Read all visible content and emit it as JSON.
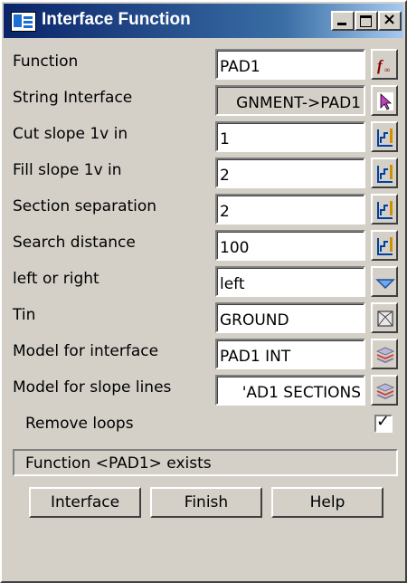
{
  "window": {
    "title": "Interface Function"
  },
  "rows": [
    {
      "label": "Function",
      "value": "PAD1",
      "icon": "function-fx-icon"
    },
    {
      "label": "String Interface",
      "value": "GNMENT->PAD1",
      "icon": "pick-arrow-icon"
    },
    {
      "label": "Cut slope  1v in",
      "value": "1",
      "icon": "value-select-icon"
    },
    {
      "label": "Fill slope 1v in",
      "value": "2",
      "icon": "value-select-icon"
    },
    {
      "label": "Section separation",
      "value": "2",
      "icon": "value-select-icon"
    },
    {
      "label": "Search distance",
      "value": "100",
      "icon": "value-select-icon"
    },
    {
      "label": "left or right",
      "value": "left",
      "icon": "dropdown-arrow-icon"
    },
    {
      "label": "Tin",
      "value": "GROUND",
      "icon": "tin-icon"
    },
    {
      "label": "Model for interface",
      "value": "PAD1 INT",
      "icon": "model-layers-icon"
    },
    {
      "label": "Model for slope lines",
      "value": "'AD1 SECTIONS",
      "icon": "model-layers-icon"
    }
  ],
  "remove_loops": {
    "label": "Remove loops",
    "checked": true
  },
  "status": {
    "message": "Function <PAD1> exists"
  },
  "buttons": {
    "interface": "Interface",
    "finish": "Finish",
    "help": "Help"
  },
  "colors": {
    "title_bar": "#0a246a",
    "face": "#d4d0c8",
    "accent_icon": "#c08000"
  }
}
